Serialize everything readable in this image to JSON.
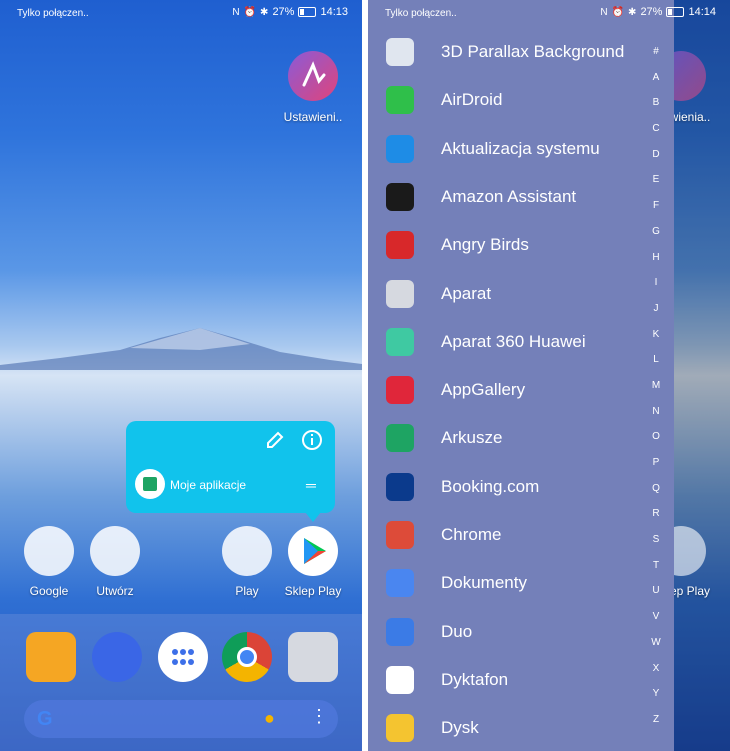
{
  "left_screen": {
    "status": {
      "carrier": "Tylko połączen..",
      "battery": "27%",
      "time": "14:13"
    },
    "desktop": {
      "ustawienia_label": "Ustawieni.."
    },
    "popup": {
      "label": "Moje aplikacje"
    },
    "row": {
      "google": "Google",
      "utworz": "Utwórz",
      "play": "Play",
      "sklep": "Sklep Play"
    }
  },
  "right_screen": {
    "status": {
      "carrier": "Tylko połączen..",
      "battery": "27%",
      "time": "14:14"
    },
    "apps": [
      {
        "name": "3D Parallax Background",
        "icon": "parallax-icon",
        "color": "#e0e6ef"
      },
      {
        "name": "AirDroid",
        "icon": "airdroid-icon",
        "color": "#2fbf4a"
      },
      {
        "name": "Aktualizacja systemu",
        "icon": "emui-icon",
        "color": "#1e8ce6"
      },
      {
        "name": "Amazon Assistant",
        "icon": "amazon-icon",
        "color": "#1a1a1a"
      },
      {
        "name": "Angry Birds",
        "icon": "angry-birds-icon",
        "color": "#d8282a"
      },
      {
        "name": "Aparat",
        "icon": "camera-icon",
        "color": "#d6d9e0"
      },
      {
        "name": "Aparat 360 Huawei",
        "icon": "camera360-icon",
        "color": "#3fc9a2"
      },
      {
        "name": "AppGallery",
        "icon": "appgallery-icon",
        "color": "#e0263a"
      },
      {
        "name": "Arkusze",
        "icon": "sheets-icon",
        "color": "#1ea463"
      },
      {
        "name": "Booking.com",
        "icon": "booking-icon",
        "color": "#0b3a8c"
      },
      {
        "name": "Chrome",
        "icon": "chrome-icon",
        "color": "#dd4b39"
      },
      {
        "name": "Dokumenty",
        "icon": "docs-icon",
        "color": "#4a86f0"
      },
      {
        "name": "Duo",
        "icon": "duo-icon",
        "color": "#3b7be6"
      },
      {
        "name": "Dyktafon",
        "icon": "recorder-icon",
        "color": "#ffffff"
      },
      {
        "name": "Dysk",
        "icon": "drive-icon",
        "color": "#f4c430"
      }
    ],
    "index": [
      "#",
      "A",
      "B",
      "C",
      "D",
      "E",
      "F",
      "G",
      "H",
      "I",
      "J",
      "K",
      "L",
      "M",
      "N",
      "O",
      "P",
      "Q",
      "R",
      "S",
      "T",
      "U",
      "V",
      "W",
      "X",
      "Y",
      "Z"
    ],
    "behind": {
      "ustawienia": "wienia..",
      "sklep": "ep Play"
    }
  },
  "icons": [
    "signal-icon",
    "wifi-icon",
    "nfc-icon",
    "alarm-icon",
    "bluetooth-icon",
    "battery-icon",
    "edit-icon",
    "info-icon",
    "mic-icon",
    "more-icon",
    "google-g-icon",
    "apps-grid-icon",
    "contacts-icon",
    "messages-icon",
    "chrome-icon",
    "camera-icon",
    "play-store-icon"
  ]
}
